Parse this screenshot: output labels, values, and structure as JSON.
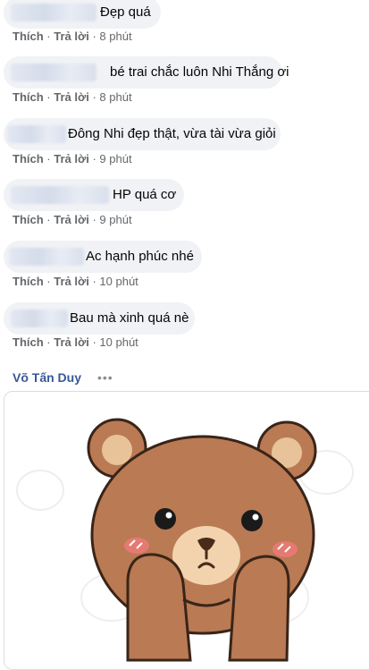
{
  "comments": [
    {
      "text": "Đẹp quá",
      "time": "8 phút"
    },
    {
      "text": "bé trai chắc luôn Nhi Thắng ơi",
      "time": "8 phút"
    },
    {
      "text": "Đông Nhi đẹp thật, vừa tài vừa giỏi",
      "time": "9 phút"
    },
    {
      "text": "HP quá cơ",
      "time": "9 phút"
    },
    {
      "text": "Ac hạnh phúc nhé",
      "time": "10 phút"
    },
    {
      "text": "Bau mà xinh quá nè",
      "time": "10 phút"
    }
  ],
  "actions": {
    "like": "Thích",
    "reply": "Trả lời",
    "sep": "·"
  },
  "last_comment": {
    "author": "Võ Tấn Duy",
    "more": "•••",
    "sticker": "bear-sticker"
  }
}
